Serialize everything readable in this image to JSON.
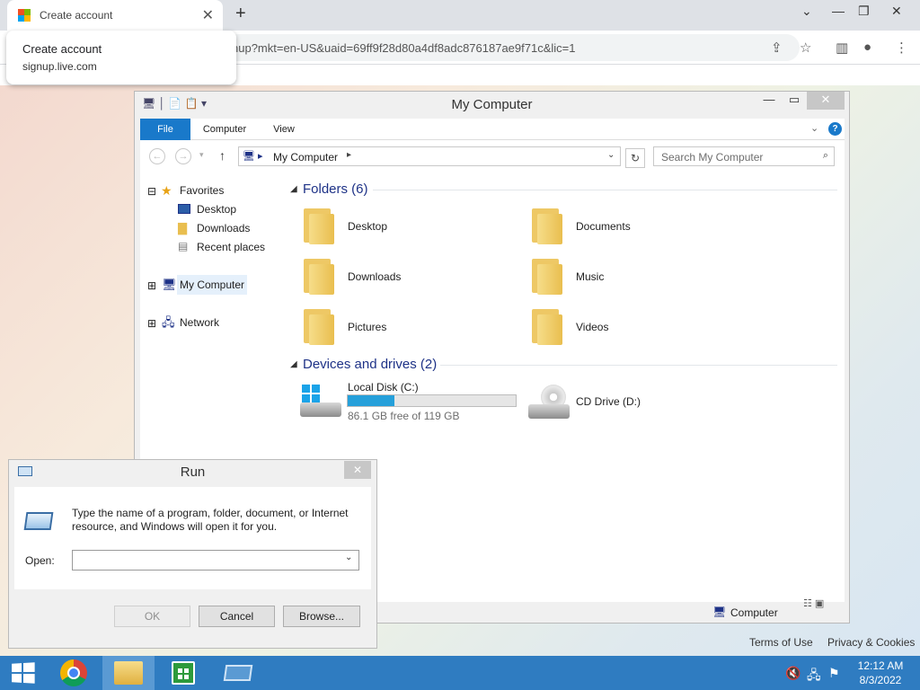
{
  "browser": {
    "tab_title": "Create account",
    "url": "signup.live.com/?lic=1&uaid=69ff9f28d80a4df8adc876187ae9f71c&mkt=en-US",
    "url_visible": "nup?mkt=en-US&uaid=69ff9f28d80a4df8adc876187ae9f71c&lic=1",
    "popup": {
      "title": "Create account",
      "domain": "signup.live.com"
    },
    "footer_links": [
      "Terms of Use",
      "Privacy & Cookies"
    ]
  },
  "explorer": {
    "title": "My Computer",
    "ribbon_tabs": [
      "File",
      "Computer",
      "View"
    ],
    "address": "My Computer",
    "search_placeholder": "Search My Computer",
    "tree": {
      "favorites": "Favorites",
      "desktop": "Desktop",
      "downloads": "Downloads",
      "recent": "Recent places",
      "my_computer": "My Computer",
      "network": "Network"
    },
    "folders_header": "Folders (6)",
    "folders": [
      "Desktop",
      "Documents",
      "Downloads",
      "Music",
      "Pictures",
      "Videos"
    ],
    "drives_header": "Devices and drives (2)",
    "drive_c": {
      "name": "Local Disk (C:)",
      "free_text": "86.1 GB free of 119 GB",
      "used_fraction": 0.277
    },
    "drive_d": {
      "name": "CD Drive (D:)"
    },
    "status_label": "Computer"
  },
  "run": {
    "title": "Run",
    "description": "Type the name of a program, folder, document, or Internet resource, and Windows will open it for you.",
    "open_label": "Open:",
    "open_value": "",
    "ok": "OK",
    "cancel": "Cancel",
    "browse": "Browse..."
  },
  "taskbar": {
    "time": "12:12 AM",
    "date": "8/3/2022",
    "accent": "#2f7cc1"
  },
  "colors": {
    "ribbon_file": "#1979ca",
    "header_blue": "#1e3287",
    "progress": "#26a0da"
  }
}
